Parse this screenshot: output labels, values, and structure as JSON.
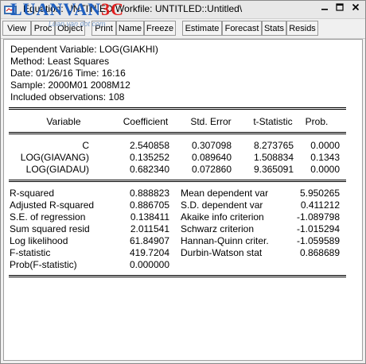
{
  "window": {
    "title": "Equation: UNTITLED   Workfile: UNTITLED::Untitled\\",
    "logo_text": "LUANVAN",
    "logo_suffix": "3C",
    "logo_sub": "Luan van dot com"
  },
  "toolbar": {
    "buttons": [
      "View",
      "Proc",
      "Object",
      "Print",
      "Name",
      "Freeze",
      "Estimate",
      "Forecast",
      "Stats",
      "Resids"
    ]
  },
  "header": {
    "dependent": "Dependent Variable: LOG(GIAKHI)",
    "method": "Method: Least Squares",
    "date": "Date: 01/26/16   Time: 16:16",
    "sample": "Sample: 2000M01 2008M12",
    "observations": "Included observations: 108"
  },
  "coef_table": {
    "columns": [
      "Variable",
      "Coefficient",
      "Std. Error",
      "t-Statistic",
      "Prob."
    ],
    "rows": [
      {
        "variable": "C",
        "coefficient": "2.540858",
        "std_error": "0.307098",
        "t_stat": "8.273765",
        "prob": "0.0000"
      },
      {
        "variable": "LOG(GIAVANG)",
        "coefficient": "0.135252",
        "std_error": "0.089640",
        "t_stat": "1.508834",
        "prob": "0.1343"
      },
      {
        "variable": "LOG(GIADAU)",
        "coefficient": "0.682340",
        "std_error": "0.072860",
        "t_stat": "9.365091",
        "prob": "0.0000"
      }
    ]
  },
  "stats": {
    "left": [
      {
        "label": "R-squared",
        "value": "0.888823"
      },
      {
        "label": "Adjusted R-squared",
        "value": "0.886705"
      },
      {
        "label": "S.E. of regression",
        "value": "0.138411"
      },
      {
        "label": "Sum squared resid",
        "value": "2.011541"
      },
      {
        "label": "Log likelihood",
        "value": "61.84907"
      },
      {
        "label": "F-statistic",
        "value": "419.7204"
      },
      {
        "label": "Prob(F-statistic)",
        "value": "0.000000"
      }
    ],
    "right": [
      {
        "label": "Mean dependent var",
        "value": "5.950265"
      },
      {
        "label": "S.D. dependent var",
        "value": "0.411212"
      },
      {
        "label": "Akaike info criterion",
        "value": "-1.089798"
      },
      {
        "label": "Schwarz criterion",
        "value": "-1.015294"
      },
      {
        "label": "Hannan-Quinn criter.",
        "value": "-1.059589"
      },
      {
        "label": "Durbin-Watson stat",
        "value": "0.868689"
      }
    ]
  }
}
